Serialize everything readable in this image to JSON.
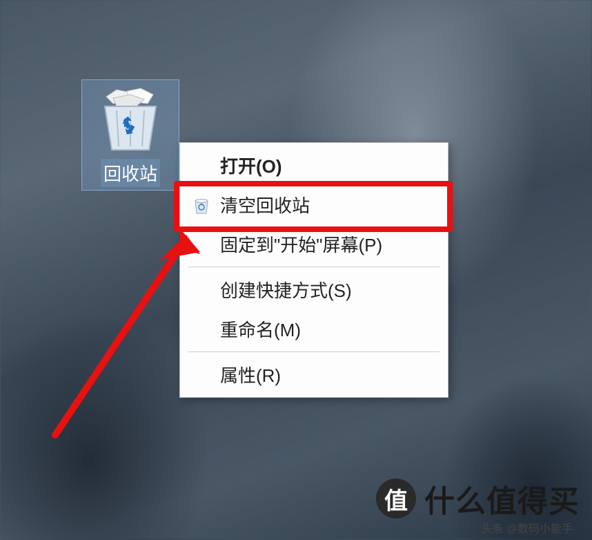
{
  "desktop": {
    "icon": {
      "name": "recycle-bin",
      "label": "回收站"
    }
  },
  "context_menu": {
    "items": [
      {
        "label": "打开(O)",
        "bold": true,
        "icon": null
      },
      {
        "label": "清空回收站",
        "bold": false,
        "icon": "recycle-bin-small",
        "highlighted": true
      },
      {
        "label": "固定到\"开始\"屏幕(P)",
        "bold": false,
        "icon": null
      }
    ],
    "group2": [
      {
        "label": "创建快捷方式(S)"
      },
      {
        "label": "重命名(M)"
      }
    ],
    "group3": [
      {
        "label": "属性(R)"
      }
    ]
  },
  "watermark": {
    "badge": "值",
    "text": "什么值得买",
    "sub": "头条 @数码小能手"
  },
  "annotation": {
    "highlight_color": "#e81010",
    "arrow_color": "#e81010"
  }
}
